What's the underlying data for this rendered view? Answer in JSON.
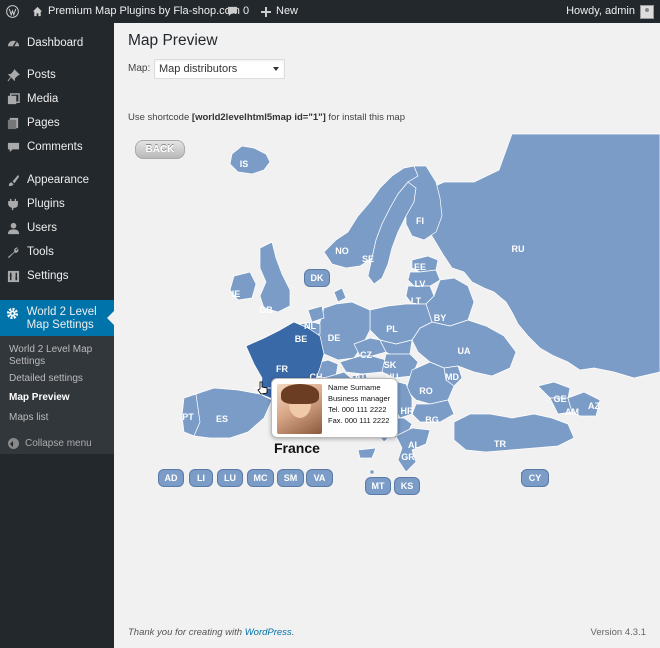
{
  "adminbar": {
    "site_name": "Premium Map Plugins by Fla-shop.com",
    "comments_count": "0",
    "new_label": "New",
    "howdy": "Howdy, admin"
  },
  "sidebar": {
    "items": [
      {
        "label": "Dashboard",
        "icon": "dashboard-icon"
      },
      {
        "label": "Posts",
        "icon": "pin-icon"
      },
      {
        "label": "Media",
        "icon": "media-icon"
      },
      {
        "label": "Pages",
        "icon": "pages-icon"
      },
      {
        "label": "Comments",
        "icon": "comment-icon"
      },
      {
        "label": "Appearance",
        "icon": "brush-icon"
      },
      {
        "label": "Plugins",
        "icon": "plugin-icon"
      },
      {
        "label": "Users",
        "icon": "users-icon"
      },
      {
        "label": "Tools",
        "icon": "wrench-icon"
      },
      {
        "label": "Settings",
        "icon": "settings-icon"
      },
      {
        "label": "World 2 Level Map Settings",
        "icon": "gear-icon"
      }
    ],
    "submenu": [
      {
        "label": "World 2 Level Map Settings"
      },
      {
        "label": "Detailed settings"
      },
      {
        "label": "Map Preview"
      },
      {
        "label": "Maps list"
      }
    ],
    "collapse_label": "Collapse menu"
  },
  "main": {
    "title": "Map Preview",
    "map_label": "Map:",
    "map_select_value": "Map distributors",
    "shortcode_prefix": "Use shortcode ",
    "shortcode": "[world2levelhtml5map id=\"1\"]",
    "shortcode_suffix": " for install this map"
  },
  "map": {
    "back_label": "BACK",
    "country_labels": [
      "IS",
      "FI",
      "NO",
      "SE",
      "RU",
      "EE",
      "LV",
      "LT",
      "DK",
      "IE",
      "GB",
      "BY",
      "NL",
      "BE",
      "DE",
      "PL",
      "UA",
      "FR",
      "CZ",
      "SK",
      "CH",
      "AT",
      "HU",
      "MD",
      "RO",
      "SI",
      "HR",
      "BA",
      "RS",
      "BG",
      "IT",
      "ME",
      "MK",
      "AL",
      "GR",
      "PT",
      "ES",
      "GE",
      "AM",
      "AZ",
      "TR",
      "CY",
      "MT",
      "KS"
    ],
    "small_buttons": [
      "AD",
      "LI",
      "LU",
      "MC",
      "SM",
      "VA"
    ],
    "selected_country": "France",
    "tooltip": {
      "name": "Name Surname",
      "position": "Business manager",
      "tel": "Tel. 000 111 2222",
      "fax": "Fax. 000 111 2222"
    },
    "colors": {
      "land": "#7b9cc6",
      "selected": "#3a69a8",
      "border": "#ffffff"
    }
  },
  "footer": {
    "thanks_prefix": "Thank you for creating with ",
    "thanks_link": "WordPress",
    "thanks_suffix": ".",
    "version": "Version 4.3.1"
  }
}
